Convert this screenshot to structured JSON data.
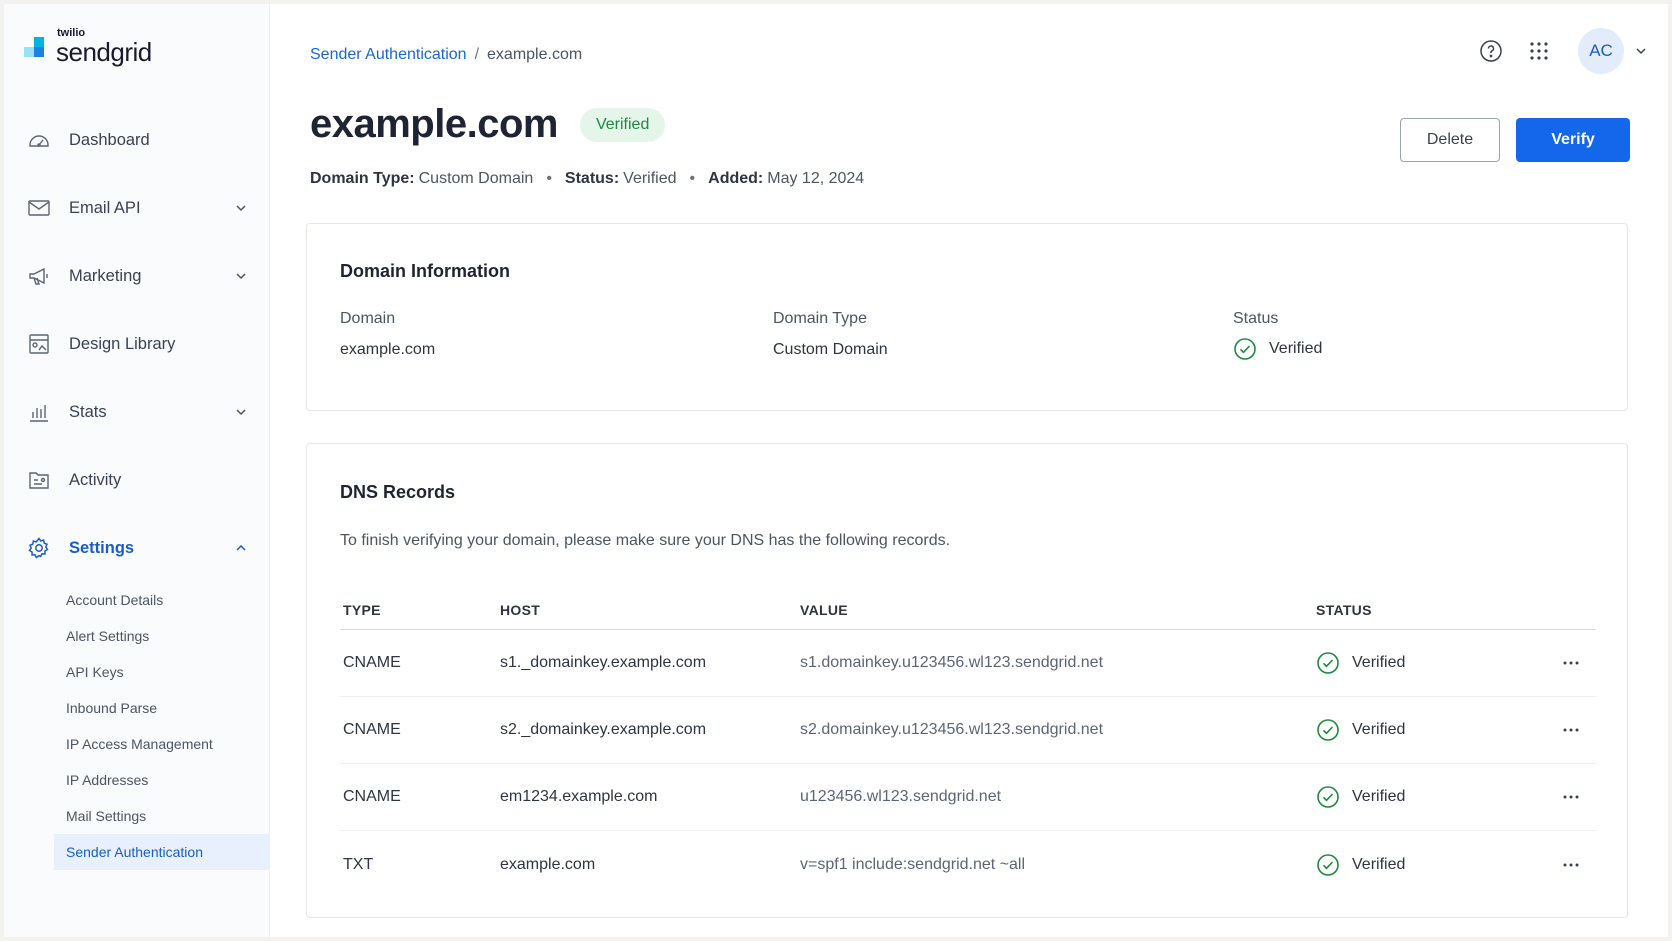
{
  "logo": {
    "small": "twilio",
    "big": "sendgrid"
  },
  "sidebar": {
    "items": [
      {
        "label": "Dashboard",
        "icon": "dashboard-icon"
      },
      {
        "label": "Email API",
        "icon": "envelope-icon"
      },
      {
        "label": "Marketing",
        "icon": "megaphone-icon"
      },
      {
        "label": "Design Library",
        "icon": "design-library-icon"
      },
      {
        "label": "Stats",
        "icon": "stats-icon"
      },
      {
        "label": "Activity",
        "icon": "activity-icon"
      },
      {
        "label": "Settings",
        "icon": "gear-icon"
      }
    ],
    "settings_sub": [
      "Account Details",
      "Alert Settings",
      "API Keys",
      "Inbound Parse",
      "IP Access Management",
      "IP Addresses",
      "Mail Settings",
      "Sender Authentication"
    ]
  },
  "breadcrumb": {
    "parent": "Sender Authentication",
    "separator": "/",
    "current": "example.com"
  },
  "user": {
    "initials": "AC"
  },
  "page": {
    "title": "example.com",
    "badge": "Verified",
    "delete_label": "Delete",
    "verify_label": "Verify",
    "meta": {
      "domain_type_label": "Domain Type:",
      "domain_type_value": "Custom Domain",
      "status_label": "Status:",
      "status_value": "Verified",
      "added_label": "Added:",
      "added_value": "May 12, 2024"
    }
  },
  "domain_info": {
    "title": "Domain Information",
    "domain_label": "Domain",
    "domain_value": "example.com",
    "type_label": "Domain Type",
    "type_value": "Custom Domain",
    "status_label": "Status",
    "status_value": "Verified"
  },
  "dns": {
    "title": "DNS Records",
    "description": "To finish verifying your domain, please make sure your DNS has the following records.",
    "headers": {
      "type": "TYPE",
      "host": "HOST",
      "value": "VALUE",
      "status": "STATUS"
    },
    "rows": [
      {
        "type": "CNAME",
        "host": "s1._domainkey.example.com",
        "value": "s1.domainkey.u123456.wl123.sendgrid.net",
        "status": "Verified"
      },
      {
        "type": "CNAME",
        "host": "s2._domainkey.example.com",
        "value": "s2.domainkey.u123456.wl123.sendgrid.net",
        "status": "Verified"
      },
      {
        "type": "CNAME",
        "host": "em1234.example.com",
        "value": "u123456.wl123.sendgrid.net",
        "status": "Verified"
      },
      {
        "type": "TXT",
        "host": "example.com",
        "value": "v=spf1 include:sendgrid.net ~all",
        "status": "Verified"
      }
    ]
  },
  "colors": {
    "accent": "#1466ea",
    "success": "#1e8a3e",
    "active_nav": "#1a5cc8"
  }
}
